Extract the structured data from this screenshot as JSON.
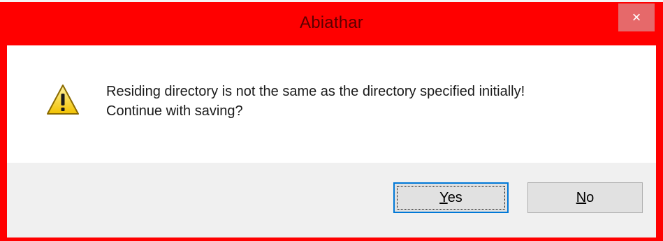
{
  "dialog": {
    "title": "Abiathar",
    "close_glyph": "×",
    "icon": "warning-icon",
    "message_lines": [
      "Residing directory is not the same as the directory specified initially!",
      "Continue with saving?"
    ],
    "buttons": {
      "yes": {
        "mnemonic": "Y",
        "rest": "es"
      },
      "no": {
        "mnemonic": "N",
        "rest": "o"
      }
    }
  },
  "colors": {
    "frame": "#ff0000",
    "title_text": "#5a0000",
    "close_button": "#e6696a",
    "footer": "#f0f0f0",
    "focus_border": "#0078d7"
  }
}
